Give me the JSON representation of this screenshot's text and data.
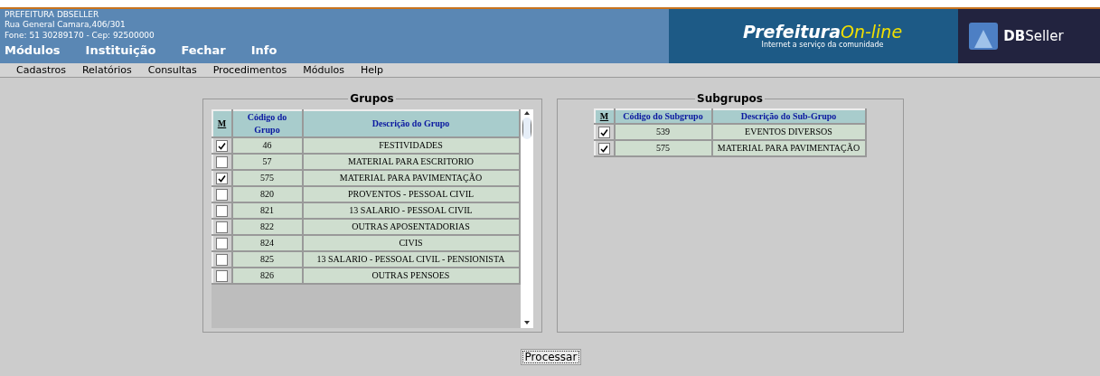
{
  "header": {
    "org_name": "PREFEITURA DBSELLER",
    "address": "Rua General Camara,406/301",
    "contact": "Fone: 51 30289170  -  Cep: 92500000",
    "top_menu": [
      "Módulos",
      "Instituição",
      "Fechar",
      "Info"
    ],
    "brand_title": "Prefeitura",
    "brand_suffix": "On-line",
    "brand_tagline": "Internet a serviço da comunidade",
    "vendor_bold": "DB",
    "vendor_rest": "Seller"
  },
  "menu_bar": [
    "Cadastros",
    "Relatórios",
    "Consultas",
    "Procedimentos",
    "Módulos",
    "Help"
  ],
  "grupos": {
    "title": "Grupos",
    "columns": [
      "M",
      "Código do Grupo",
      "Descrição do Grupo"
    ],
    "rows": [
      {
        "code": "46",
        "description": "FESTIVIDADES",
        "checked": true
      },
      {
        "code": "57",
        "description": "MATERIAL PARA ESCRITORIO",
        "checked": false
      },
      {
        "code": "575",
        "description": "MATERIAL PARA PAVIMENTAÇÃO",
        "checked": true
      },
      {
        "code": "820",
        "description": "PROVENTOS - PESSOAL CIVIL",
        "checked": false
      },
      {
        "code": "821",
        "description": "13 SALARIO - PESSOAL CIVIL",
        "checked": false
      },
      {
        "code": "822",
        "description": "OUTRAS APOSENTADORIAS",
        "checked": false
      },
      {
        "code": "824",
        "description": "CIVIS",
        "checked": false
      },
      {
        "code": "825",
        "description": "13 SALARIO - PESSOAL CIVIL - PENSIONISTA",
        "checked": false
      },
      {
        "code": "826",
        "description": "OUTRAS PENSOES",
        "checked": false
      }
    ]
  },
  "subgrupos": {
    "title": "Subgrupos",
    "columns": [
      "M",
      "Código do Subgrupo",
      "Descrição do Sub-Grupo"
    ],
    "rows": [
      {
        "code": "539",
        "description": "EVENTOS DIVERSOS",
        "checked": true
      },
      {
        "code": "575",
        "description": "MATERIAL PARA PAVIMENTAÇÃO",
        "checked": true
      }
    ]
  },
  "process_button": "Processar"
}
